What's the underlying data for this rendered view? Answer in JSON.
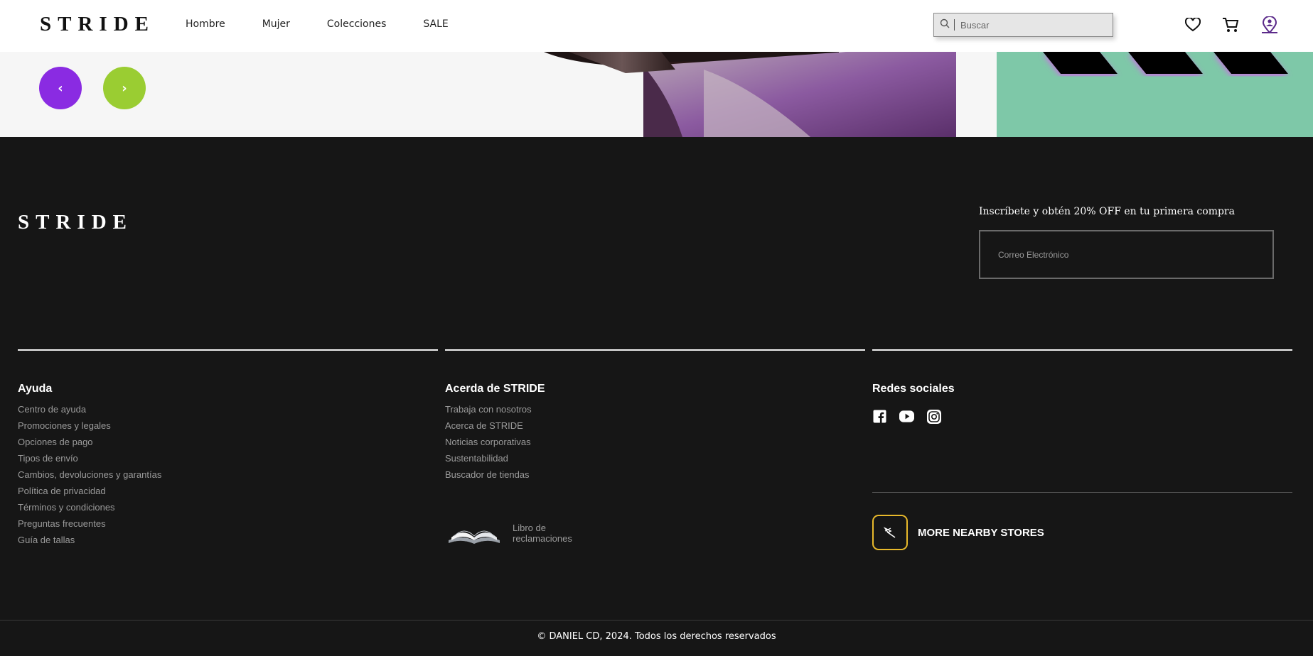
{
  "header": {
    "logo": "STRIDE",
    "nav": [
      "Hombre",
      "Mujer",
      "Colecciones",
      "SALE"
    ],
    "search": {
      "placeholder": "Buscar"
    },
    "icons": [
      "heart-icon",
      "cart-icon",
      "user-location-icon"
    ]
  },
  "hero": {
    "prev_label": "‹",
    "next_label": "›",
    "colors": {
      "prev": "#8a2be2",
      "next": "#9acd32",
      "panel": "#7ec8a8"
    }
  },
  "footer": {
    "logo": "STRIDE",
    "newsletter": {
      "title": "Inscríbete y obtén 20% OFF en tu primera compra",
      "placeholder": "Correo Electrónico"
    },
    "columns": [
      {
        "title": "Ayuda",
        "links": [
          "Centro de ayuda",
          "Promociones y legales",
          "Opciones de pago",
          "Tipos de envío",
          "Cambios, devoluciones y garantías",
          "Política de privacidad",
          "Términos y condiciones",
          "Preguntas frecuentes",
          "Guía de tallas"
        ]
      },
      {
        "title": "Acerda de STRIDE",
        "links": [
          "Trabaja con nosotros",
          "Acerca de STRIDE",
          "Noticias corporativas",
          "Sustentabilidad",
          "Buscador de tiendas"
        ]
      },
      {
        "title": "Redes sociales",
        "links": []
      }
    ],
    "complaints_book": {
      "line1": "Libro de",
      "line2": "reclamaciones"
    },
    "social_icons": [
      "facebook-icon",
      "youtube-icon",
      "instagram-icon"
    ],
    "stores_label": "MORE NEARBY STORES",
    "copyright": "© DANIEL CD, 2024. Todos los derechos reservados",
    "accent": "#e8b92b"
  }
}
